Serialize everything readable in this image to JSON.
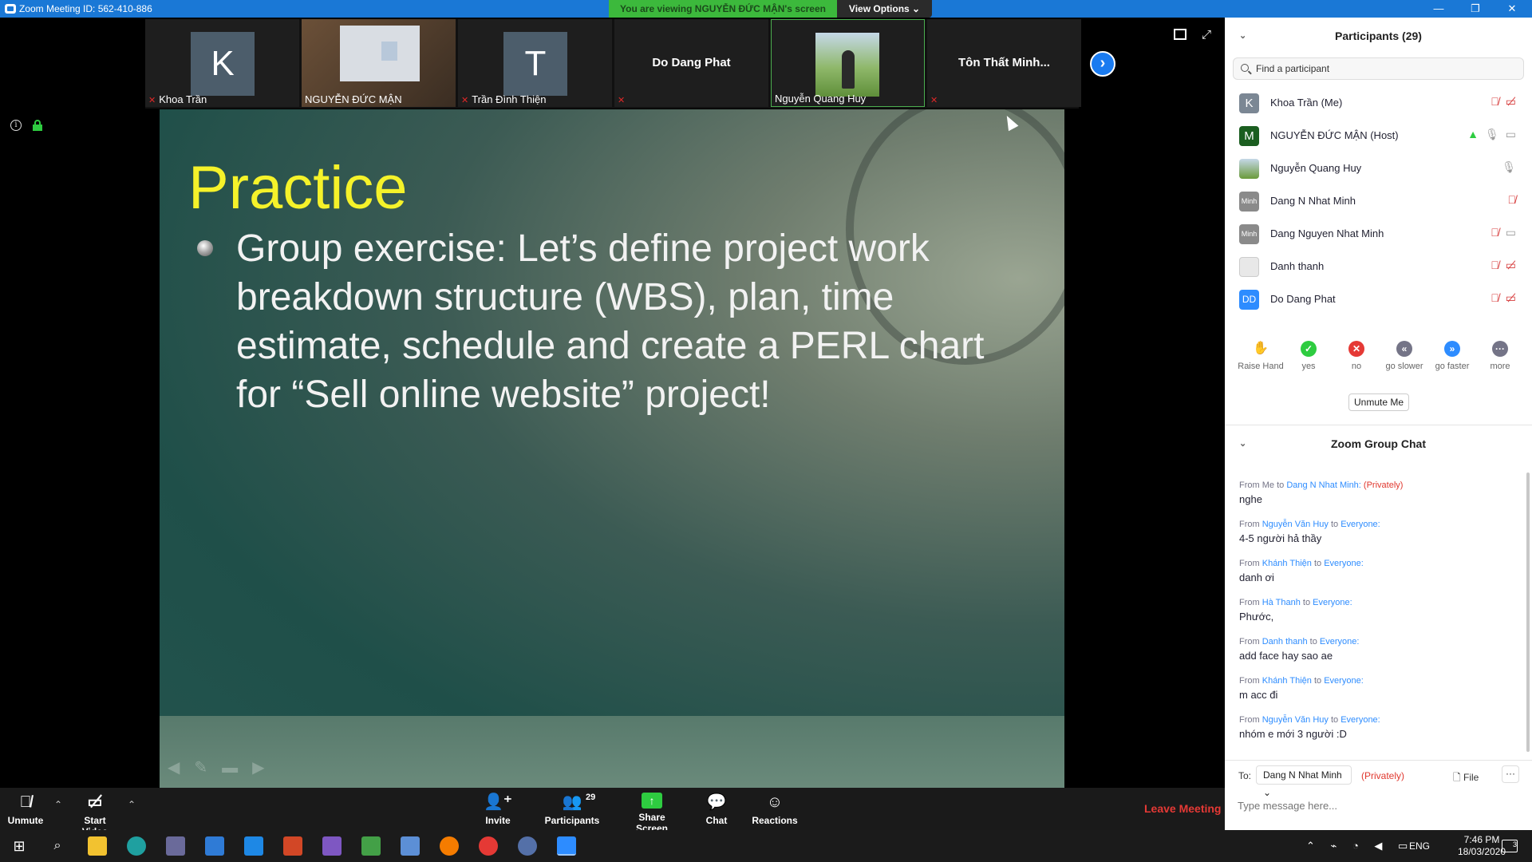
{
  "window": {
    "title": "Zoom Meeting ID: 562-410-886",
    "viewing_banner": "You are viewing NGUYỄN ĐỨC MẬN's screen",
    "view_options": "View Options ⌄",
    "minimize": "—",
    "maximize": "❐",
    "close": "✕"
  },
  "filmstrip": {
    "tiles": [
      {
        "avatar_letter": "K",
        "name": "Khoa Trần",
        "muted": true
      },
      {
        "name": "NGUYỄN ĐỨC MẬN",
        "muted": false
      },
      {
        "avatar_letter": "T",
        "name": "Trần Đình Thiện",
        "muted": true
      },
      {
        "center_name": "Do Dang Phat",
        "muted": true
      },
      {
        "name": "Nguyễn Quang Huy",
        "muted": false,
        "active": true
      },
      {
        "center_name": "Tôn Thất Minh...",
        "muted": true
      }
    ],
    "muted_glyph": "🎤"
  },
  "slide": {
    "title": "Practice",
    "bullet_text": "Group exercise: Let’s define project work breakdown structure (WBS), plan, time estimate, schedule and create a PERL chart for “Sell online website” project!"
  },
  "participants_panel": {
    "title": "Participants (29)",
    "search_placeholder": "Find a participant",
    "participants": [
      {
        "avatar": "K",
        "avatar_color": "#7b8794",
        "name": "Khoa Trần (Me)",
        "mic": "muted",
        "video": "off"
      },
      {
        "avatar": "M",
        "avatar_color": "#1b5e20",
        "name": "NGUYỄN ĐỨC MẬN (Host)",
        "sharing": true,
        "mic": "on",
        "video": "on"
      },
      {
        "avatar": "",
        "avatar_color": "#6a9a3a",
        "name": "Nguyễn Quang Huy",
        "mic": "on"
      },
      {
        "avatar": "Minh",
        "avatar_color": "#8a8a8a",
        "name": "Dang N Nhat Minh",
        "mic": "muted"
      },
      {
        "avatar": "Minh",
        "avatar_color": "#8a8a8a",
        "name": "Dang Nguyen Nhat Minh",
        "mic": "muted",
        "video": "on"
      },
      {
        "avatar": "",
        "avatar_color": "#e8e8e8",
        "name": "Danh thanh",
        "mic": "muted",
        "video": "off"
      },
      {
        "avatar": "DD",
        "avatar_color": "#2d8cff",
        "name": "Do Dang Phat",
        "mic": "muted",
        "video": "off"
      }
    ],
    "reactions": [
      {
        "label": "Raise Hand",
        "glyph": "✋",
        "color": "#2d8cff"
      },
      {
        "label": "yes",
        "glyph": "✓",
        "color": "#2ecc40"
      },
      {
        "label": "no",
        "glyph": "✕",
        "color": "#e53935"
      },
      {
        "label": "go slower",
        "glyph": "«",
        "color": "#747487"
      },
      {
        "label": "go faster",
        "glyph": "»",
        "color": "#2d8cff"
      },
      {
        "label": "more",
        "glyph": "···",
        "color": "#747487"
      }
    ],
    "unmute_me": "Unmute Me"
  },
  "chat_panel": {
    "title": "Zoom Group Chat",
    "messages": [
      {
        "from": "Me",
        "to": "Dang N Nhat Minh:",
        "private": "(Privately)",
        "text": "nghe"
      },
      {
        "from": "Nguyễn Văn Huy",
        "to": "Everyone:",
        "text": "4-5 người hả thầy"
      },
      {
        "from": "Khánh Thiện",
        "to": "Everyone:",
        "text": "danh ơi"
      },
      {
        "from": "Hà Thanh",
        "to": "Everyone:",
        "text": "Phước,"
      },
      {
        "from": "Danh thanh",
        "to": "Everyone:",
        "text": "add face hay sao ae"
      },
      {
        "from": "Khánh Thiện",
        "to": "Everyone:",
        "text": "m acc đi"
      },
      {
        "from": "Nguyễn Văn Huy",
        "to": "Everyone:",
        "text": "nhóm e mới 3 người :D"
      }
    ],
    "to_label": "To:",
    "to_value": "Dang N Nhat Minh ⌄",
    "privately": "(Privately)",
    "file_label": "File",
    "more": "···",
    "input_placeholder": "Type message here..."
  },
  "toolbar": {
    "unmute": "Unmute",
    "start_video": "Start Video",
    "invite": "Invite",
    "participants": "Participants",
    "participants_count": "29",
    "share_screen": "Share Screen",
    "chat": "Chat",
    "reactions": "Reactions",
    "leave": "Leave Meeting"
  },
  "taskbar": {
    "language": "ENG",
    "time": "7:46 PM",
    "date": "18/03/2020",
    "notifications": "3"
  }
}
